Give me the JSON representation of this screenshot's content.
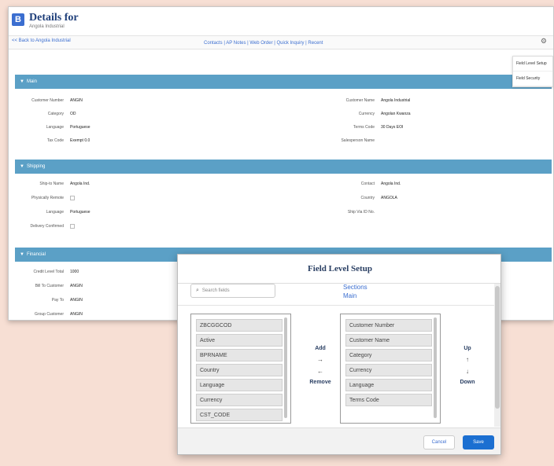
{
  "window": {
    "title": "Details for",
    "subtitle": "Angola Industrial",
    "app_icon": "B",
    "back_link": "<< Back to Angola Industrial",
    "quick_links": "Contacts | AP Notes | Web Order | Quick Inquiry | Recent",
    "settings_icon": "gear-icon",
    "settings_menu": [
      "Field Level Setup",
      "Field Security"
    ]
  },
  "sections": [
    {
      "label": "Main",
      "fields_left": [
        {
          "label": "Customer Number",
          "value": "ANGIN"
        },
        {
          "label": "Category",
          "value": "OD"
        },
        {
          "label": "Language",
          "value": "Portuguese"
        },
        {
          "label": "Tax Code",
          "value": "Exempt 0.0"
        }
      ],
      "fields_right": [
        {
          "label": "Customer Name",
          "value": "Angola Industrial"
        },
        {
          "label": "Currency",
          "value": "Angolan Kwanza"
        },
        {
          "label": "Terms Code",
          "value": "30 Days EOI"
        },
        {
          "label": "Salesperson Name",
          "value": ""
        }
      ]
    },
    {
      "label": "Shipping",
      "fields_left": [
        {
          "label": "Ship-to Name",
          "value": "Angola Ind."
        },
        {
          "label": "Physically Remote",
          "value": ""
        },
        {
          "label": "Language",
          "value": "Portuguese"
        },
        {
          "label": "Delivery Confirmed",
          "value": ""
        }
      ],
      "fields_right": [
        {
          "label": "Contact",
          "value": "Angola Ind."
        },
        {
          "label": "Country",
          "value": "ANGOLA"
        },
        {
          "label": "Ship Via ID No.",
          "value": ""
        }
      ]
    },
    {
      "label": "Financial",
      "fields_left": [
        {
          "label": "Credit Level Total",
          "value": "1000"
        },
        {
          "label": "Bill To Customer",
          "value": "ANGIN"
        },
        {
          "label": "Pay To",
          "value": "ANGIN"
        },
        {
          "label": "Group Customer",
          "value": "ANGIN"
        }
      ]
    }
  ],
  "dialog": {
    "title": "Field Level Setup",
    "search_placeholder": "Search fields",
    "sections_label": "Sections",
    "sections_value": "Main",
    "available_fields": [
      "ZBCGGCOD",
      "Active",
      "BPRNAME",
      "Country",
      "Language",
      "Currency",
      "CST_CODE"
    ],
    "selected_fields": [
      "Customer Number",
      "Customer Name",
      "Category",
      "Currency",
      "Language",
      "Terms Code"
    ],
    "add_label": "Add",
    "remove_label": "Remove",
    "up_label": "Up",
    "down_label": "Down",
    "cancel_label": "Cancel",
    "save_label": "Save",
    "colors": {
      "save": "#1b6fd1",
      "section_bar": "#5ba0c6"
    }
  }
}
